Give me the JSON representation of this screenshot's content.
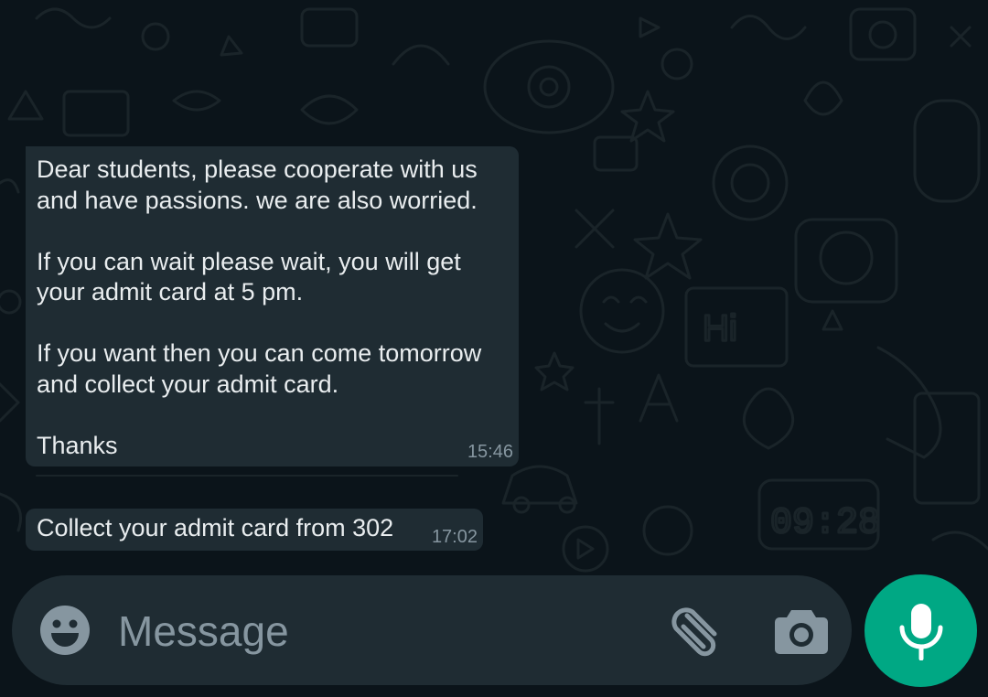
{
  "messages": [
    {
      "text": "Dear students, please cooperate with us\nand have passions. we are also worried.\n\nIf you can wait please wait, you will get\nyour admit card at 5 pm.\n\nIf you want then you can come tomorrow\nand collect your admit card.\n\nThanks",
      "time": "15:46"
    },
    {
      "text": "Collect your admit card from 302",
      "time": "17:02"
    }
  ],
  "composer": {
    "placeholder": "Message",
    "emoji_icon": "emoji-icon",
    "attach_icon": "paperclip-icon",
    "camera_icon": "camera-icon",
    "mic_icon": "microphone-icon"
  },
  "wallpaper": {
    "hi_text": "Hi",
    "clock_text": "09:28"
  },
  "colors": {
    "background": "#0b141a",
    "bubble": "#1f2c33",
    "text": "#e9edef",
    "muted": "#8696a0",
    "accent": "#00a884"
  }
}
